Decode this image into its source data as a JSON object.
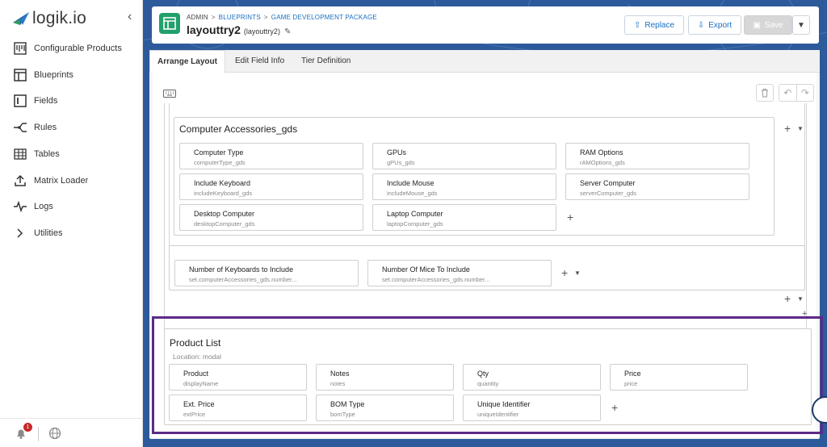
{
  "brand": {
    "name": "logik.io"
  },
  "sidebar": {
    "items": [
      {
        "label": "Configurable Products",
        "icon": "configurable-products-icon"
      },
      {
        "label": "Blueprints",
        "icon": "blueprints-icon"
      },
      {
        "label": "Fields",
        "icon": "fields-icon"
      },
      {
        "label": "Rules",
        "icon": "rules-icon"
      },
      {
        "label": "Tables",
        "icon": "tables-icon"
      },
      {
        "label": "Matrix Loader",
        "icon": "upload-icon"
      },
      {
        "label": "Logs",
        "icon": "pulse-icon"
      },
      {
        "label": "Utilities",
        "icon": "chevron-right-icon"
      }
    ],
    "notifications_count": "1"
  },
  "header": {
    "breadcrumb": [
      "ADMIN",
      "BLUEPRINTS",
      "GAME DEVELOPMENT PACKAGE"
    ],
    "title": "layouttry2",
    "subtitle": "(layouttry2)",
    "buttons": {
      "replace": "Replace",
      "export": "Export",
      "save": "Save"
    }
  },
  "tabs": [
    "Arrange Layout",
    "Edit Field Info",
    "Tier Definition"
  ],
  "accessories": {
    "title": "Computer Accessories_gds",
    "fields": [
      {
        "label": "Computer Type",
        "name": "computerType_gds"
      },
      {
        "label": "GPUs",
        "name": "gPUs_gds"
      },
      {
        "label": "RAM Options",
        "name": "rAMOptions_gds"
      },
      {
        "label": "Include Keyboard",
        "name": "includeKeyboard_gds"
      },
      {
        "label": "Include Mouse",
        "name": "includeMouse_gds"
      },
      {
        "label": "Server Computer",
        "name": "serverComputer_gds"
      },
      {
        "label": "Desktop Computer",
        "name": "desktopComputer_gds"
      },
      {
        "label": "Laptop Computer",
        "name": "laptopComputer_gds"
      }
    ]
  },
  "sets": {
    "fields": [
      {
        "label": "Number of Keyboards to Include",
        "name": "set.computerAccessories_gds.number..."
      },
      {
        "label": "Number Of Mice To Include",
        "name": "set.computerAccessories_gds.number..."
      }
    ]
  },
  "product_list": {
    "title": "Product List",
    "location": "Location: modal",
    "fields": [
      {
        "label": "Product",
        "name": "displayName"
      },
      {
        "label": "Notes",
        "name": "notes"
      },
      {
        "label": "Qty",
        "name": "quantity"
      },
      {
        "label": "Price",
        "name": "price"
      },
      {
        "label": "Ext. Price",
        "name": "extPrice"
      },
      {
        "label": "BOM Type",
        "name": "bomType"
      },
      {
        "label": "Unique Identifier",
        "name": "uniqueIdentifier"
      }
    ]
  },
  "colors": {
    "accent": "#1b6fc2",
    "blueprint_icon": "#22a06b",
    "highlight": "#5b2a86",
    "background": "#2d5a9a"
  }
}
